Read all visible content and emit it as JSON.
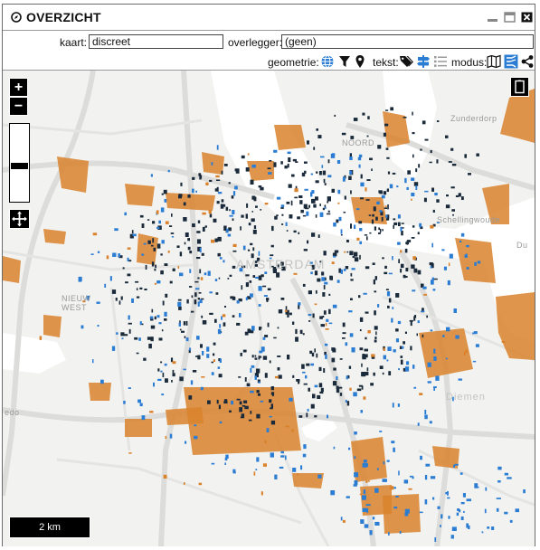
{
  "window": {
    "title": "OVERZICHT"
  },
  "controls": {
    "kaart_label": "kaart:",
    "kaart_value": "discreet",
    "overlegger_label": "overlegger:",
    "overlegger_value": "(geen)"
  },
  "toolbar": {
    "geometrie_label": "geometrie:",
    "tekst_label": "tekst:",
    "modus_label": "modus:",
    "icons": [
      "globe-icon",
      "filter-icon",
      "map-marker-icon",
      "tags-icon",
      "signpost-icon",
      "list-icon",
      "map-icon",
      "overlay-icon",
      "share-icon"
    ]
  },
  "map": {
    "scale_label": "2 km",
    "zoom_in": "+",
    "zoom_out": "−",
    "slider_level": 0.55,
    "labels": {
      "amsterdam": "AMSTERDAM",
      "nieuw_west": "NIEUW\nWEST",
      "noord": "NOORD",
      "zunderdorp": "Zunderdorp",
      "schellingwoude": "Schellingwoude",
      "diemen": "Diemen",
      "duivendrecht": "Du",
      "sloten": "edo"
    },
    "colors": {
      "building_orange": "#d9822b",
      "building_blue": "#2b7cd3",
      "building_dark": "#1a2a3a",
      "water": "#ffffff",
      "road": "#e2e2e0"
    }
  }
}
